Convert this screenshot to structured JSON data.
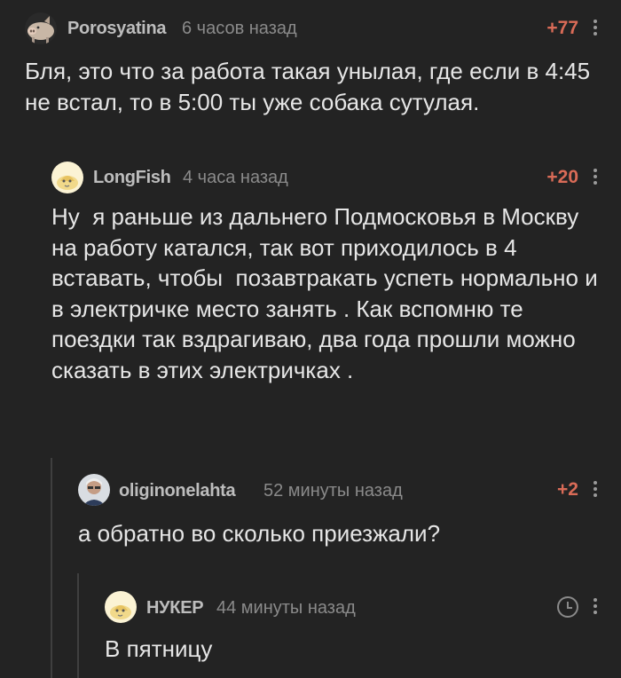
{
  "comments": [
    {
      "username": "Porosyatina",
      "time": "6 часов назад",
      "rating": "+77",
      "text": "Бля, это что за работа такая унылая, где если в 4:45 не встал, то в 5:00 ты уже собака сутулая.",
      "avatar": "pig-avatar"
    },
    {
      "username": "LongFish",
      "time": "4 часа назад",
      "rating": "+20",
      "text": "Ну  я раньше из дальнего Подмосковья в Москву на работу катался, так вот приходилось в 4 вставать, чтобы  позавтракать успеть нормально и в электричке место занять . Как вспомню те поездки так вздрагиваю, два года прошли можно сказать в этих электричках .",
      "avatar": "default-avatar"
    },
    {
      "username": "oliginonelahta",
      "time": "52 минуты назад",
      "rating": "+2",
      "text": "а обратно во сколько приезжали?",
      "avatar": "photo-avatar"
    },
    {
      "username": "НУКЕР",
      "time": "44 минуты назад",
      "rating": "",
      "text": "В пятницу",
      "avatar": "default-avatar"
    }
  ],
  "colors": {
    "background": "#232323",
    "rating": "#d96b57",
    "username": "#bdbdbd",
    "time": "#8a8a8a",
    "text": "#e6e6e6",
    "thread_line": "#3f3f3f"
  }
}
